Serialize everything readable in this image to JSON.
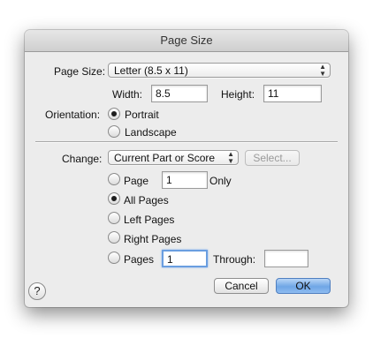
{
  "window": {
    "title": "Page Size"
  },
  "page_size": {
    "label": "Page Size:",
    "selected": "Letter (8.5 x 11)",
    "width_label": "Width:",
    "width_value": "8.5",
    "height_label": "Height:",
    "height_value": "11"
  },
  "orientation": {
    "label": "Orientation:",
    "portrait_label": "Portrait",
    "landscape_label": "Landscape",
    "selected": "Portrait"
  },
  "change": {
    "label": "Change:",
    "selected": "Current Part or Score",
    "select_button": "Select..."
  },
  "pages": {
    "page_label": "Page",
    "page_value": "1",
    "only_label": "Only",
    "all_pages_label": "All Pages",
    "left_pages_label": "Left Pages",
    "right_pages_label": "Right Pages",
    "pages_label": "Pages",
    "from_value": "1",
    "through_label": "Through:",
    "through_value": "",
    "selected": "All Pages"
  },
  "buttons": {
    "help": "?",
    "cancel": "Cancel",
    "ok": "OK"
  },
  "icons": {
    "popup_arrows": "up-down-chevrons-icon",
    "help": "help-icon"
  }
}
